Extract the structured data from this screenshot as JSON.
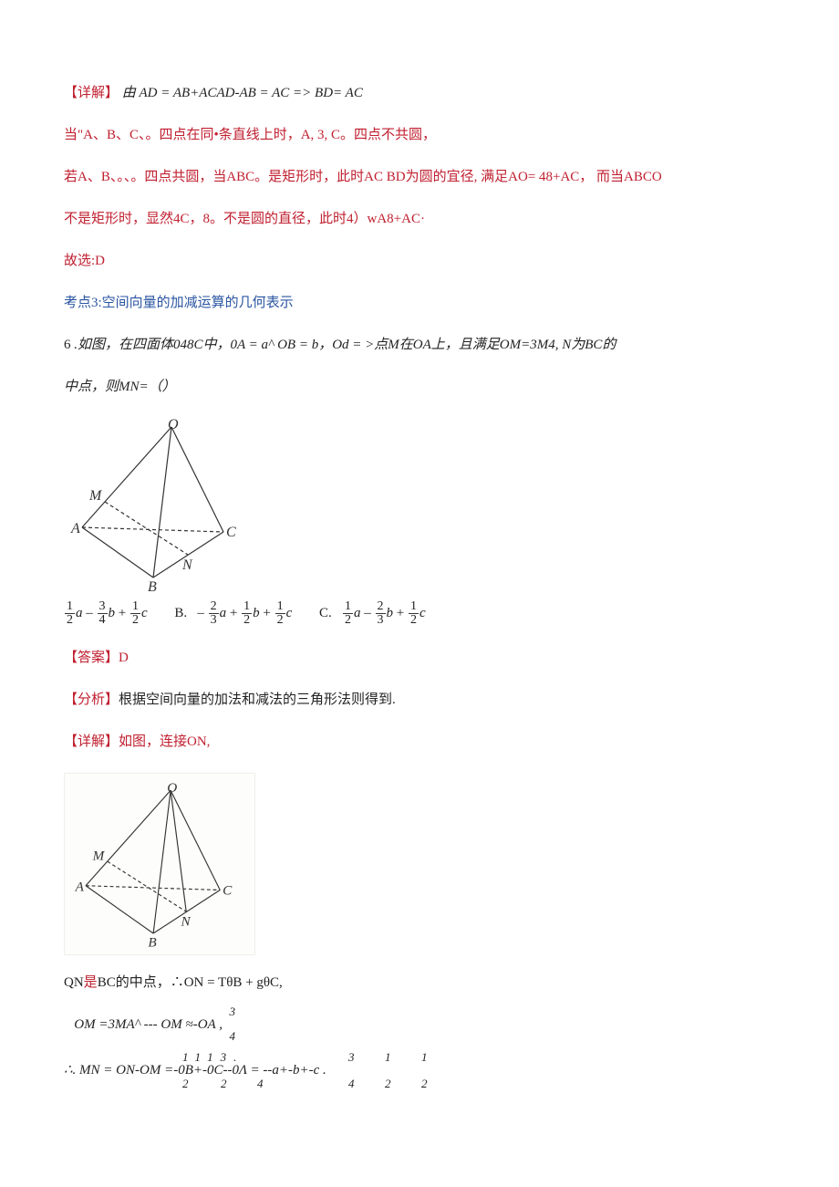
{
  "p1": {
    "tag": "【详解】",
    "rest": "由  AD = AB+ACAD-AB = AC => BD= AC"
  },
  "p2": "当\"A、B、C、。四点在同•条直线上时，A, 3, C。四点不共圆，",
  "p3": "若A、B、。、。四点共圆，当ABC。是矩形时，此时AC BD为圆的宜径, 满足AO= 48+AC， 而当ABCO",
  "p4": "不是矩形时，显然4C，8。不是圆的直径，此时4）wA8+AC·",
  "p5": "故选:D",
  "p6": "考点3:空间向量的加减运算的几何表示",
  "q6": {
    "num": "6 ",
    "body1": ".如图，在四面体048C中，0A = a^ OB = b，Od = >点M在OA上，且满足OM=3M4, N为BC的",
    "body2": "中点，则MN=（）"
  },
  "choiceA": {
    "a_top": "1",
    "a_bot": "2",
    "b_top": "3",
    "b_bot": "4",
    "c_top": "1",
    "c_bot": "2",
    "sep1": " – ",
    "sep2": " + ",
    "va": "a",
    "vb": "b",
    "vc": "c"
  },
  "choiceB": {
    "label": "B.",
    "a_top": "2",
    "a_bot": "3",
    "b_top": "1",
    "b_bot": "2",
    "c_top": "1",
    "c_bot": "2",
    "neg": "– ",
    "sep1": " + ",
    "sep2": " + ",
    "va": "a",
    "vb": "b",
    "vc": "c"
  },
  "choiceC": {
    "label": "C.",
    "a_top": "1",
    "a_bot": "2",
    "b_top": "2",
    "b_bot": "3",
    "c_top": "1",
    "c_bot": "2",
    "sep1": " – ",
    "sep2": " + ",
    "va": "a",
    "vb": "b",
    "vc": "c"
  },
  "ans": {
    "tag": "【答案】",
    "val": "D"
  },
  "analysis": {
    "tag": "【分析】",
    "rest": "根据空间向量的加法和减法的三角形法则得到."
  },
  "detail2": {
    "tag": "【详解】",
    "rest": "如图，连接ON,"
  },
  "lineQN": {
    "pre": "QN",
    "mid": "是",
    "post": "BC的中点，∴ON = TθB + gθC,"
  },
  "lineOM": {
    "indent": "   ",
    "body": "OM =3MA^ --- OM ≈-OA ,",
    "over": "3",
    "under": "4"
  },
  "lineMN": {
    "pre": "∴. MN = ON-OM =-0B+-0C--0Λ = --a+-b+-c .",
    "over": "1113.",
    "under1": "2",
    "under2": "2",
    "under3": "4",
    "r_over1": "3",
    "r_over2": "1",
    "r_over3": "1",
    "r_under1": "4",
    "r_under2": "2",
    "r_under3": "2"
  },
  "svg1": {
    "O": "O",
    "A": "A",
    "B": "B",
    "C": "C",
    "M": "M",
    "N": "N"
  },
  "svg2": {
    "O": "O",
    "A": "A",
    "B": "B",
    "C": "C",
    "M": "M",
    "N": "N"
  }
}
